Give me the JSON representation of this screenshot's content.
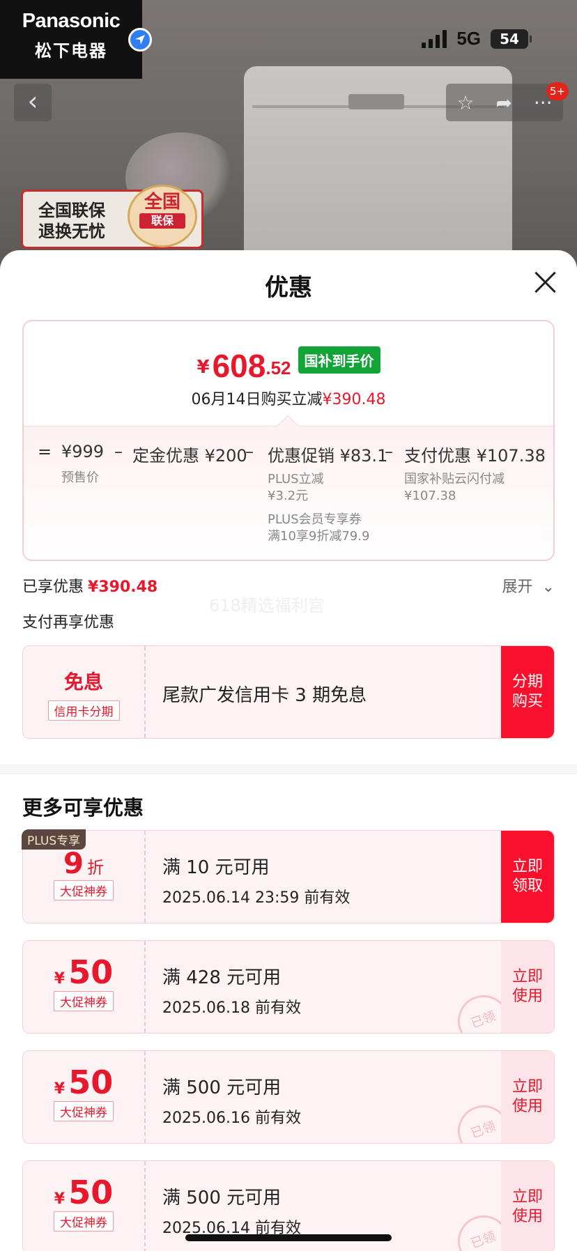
{
  "background": {
    "brand_en": "Panasonic",
    "brand_zh": "松下电器",
    "network": "5G",
    "battery": "54",
    "cart_badge": "5+",
    "sticker_line1": "全国联保",
    "sticker_line2": "退换无忧",
    "seal_top": "全国",
    "seal_bottom": "联保",
    "icons": [
      "location-arrow-icon",
      "back-icon",
      "star-icon",
      "share-icon",
      "more-icon"
    ]
  },
  "sheet": {
    "title": "优惠",
    "price": {
      "yen": "¥",
      "integer": "608",
      "decimal": ".52",
      "tag": "国补到手价",
      "subtitle_prefix": "06月14日购买立减",
      "subtitle_amount": "¥390.48"
    },
    "calculation": {
      "eq": "=",
      "minus": "–",
      "presale_value": "¥999",
      "presale_label": "预售价",
      "deposit": "定金优惠 ¥200",
      "promo": "优惠促销 ¥83.1",
      "promo_sub1": "PLUS立减",
      "promo_sub2": "¥3.2元",
      "promo_sub3": "PLUS会员专享券",
      "promo_sub4": "满10享9折减79.9",
      "payment": "支付优惠 ¥107.38",
      "payment_sub1": "国家补贴云闪付减",
      "payment_sub2": "¥107.38"
    },
    "enjoyed_label": "已享优惠",
    "enjoyed_amount": "¥390.48",
    "expand_label": "展开",
    "watermark": "618精选福利宫",
    "pay_again_label": "支付再享优惠",
    "installment": {
      "left_title": "免息",
      "left_chip": "信用卡分期",
      "text": "尾款广发信用卡 3 期免息",
      "button": "分期\n购买"
    },
    "more_title": "更多可享优惠",
    "coupons": [
      {
        "plus_tag": "PLUS专享",
        "value": "9",
        "unit": "折",
        "chip": "大促神券",
        "line1": "满 10 元可用",
        "line2": "2025.06.14 23:59 前有效",
        "button_l1": "立即",
        "button_l2": "领取"
      },
      {
        "value": "50",
        "yen": "¥",
        "chip": "大促神券",
        "line1": "满 428 元可用",
        "line2": "2025.06.18 前有效",
        "button_l1": "立即",
        "button_l2": "使用",
        "stamp": "已领"
      },
      {
        "value": "50",
        "yen": "¥",
        "chip": "大促神券",
        "line1": "满 500 元可用",
        "line2": "2025.06.16 前有效",
        "button_l1": "立即",
        "button_l2": "使用",
        "stamp": "已领"
      },
      {
        "value": "50",
        "yen": "¥",
        "chip": "大促神券",
        "line1": "满 500 元可用",
        "line2": "2025.06.14 前有效",
        "button_l1": "立即",
        "button_l2": "使用",
        "stamp": "已领"
      }
    ]
  },
  "colors": {
    "accent_red": "#e8182c",
    "green_tag": "#12a437",
    "button_red": "#f8102c"
  }
}
